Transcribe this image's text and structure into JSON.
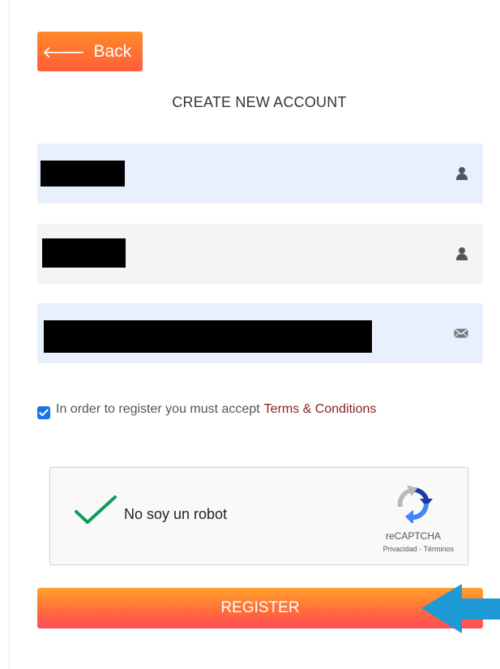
{
  "back_button": {
    "label": "Back",
    "icon": "arrow-left-icon"
  },
  "page_title": "CREATE NEW ACCOUNT",
  "form": {
    "first_name": {
      "value": "",
      "icon": "user-icon"
    },
    "last_name": {
      "value": "",
      "icon": "user-icon"
    },
    "email": {
      "value": "",
      "icon": "envelope-icon"
    }
  },
  "terms": {
    "checked": true,
    "text": "In order to register you must accept",
    "link_text": "Terms & Conditions"
  },
  "captcha": {
    "label": "No soy un robot",
    "brand": "reCAPTCHA",
    "privacy": "Privacidad",
    "separator": " - ",
    "terms": "Términos",
    "verified": true
  },
  "register_button": {
    "label": "REGISTER"
  },
  "colors": {
    "accent_orange": "#ff8a2a",
    "field_highlight": "#e8f0fe",
    "terms_link": "#8b1f1f",
    "annotation_arrow": "#1e9ad6"
  }
}
